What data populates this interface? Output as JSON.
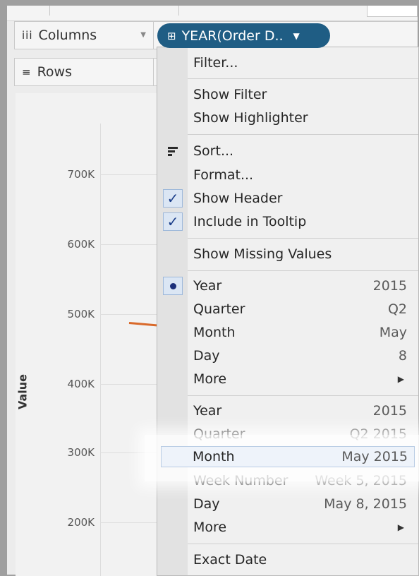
{
  "shelves": {
    "columns_label": "Columns",
    "columns_glyph": "iii",
    "rows_label": "Rows",
    "rows_glyph": "≡"
  },
  "pill": {
    "label": "YEAR(Order D..",
    "icon": "expand-plus-icon",
    "color": "#1f5d84"
  },
  "chart_data": {
    "type": "line",
    "ylabel": "Value",
    "y_ticks": [
      "700K",
      "600K",
      "500K",
      "400K",
      "300K",
      "200K"
    ],
    "series_color": "#d9692a"
  },
  "menu": {
    "filter": "Filter...",
    "show_filter": "Show Filter",
    "show_highlighter": "Show Highlighter",
    "sort": "Sort...",
    "format": "Format...",
    "show_header": "Show Header",
    "include_tooltip": "Include in Tooltip",
    "show_missing": "Show Missing Values",
    "discrete": [
      {
        "label": "Year",
        "value": "2015"
      },
      {
        "label": "Quarter",
        "value": "Q2"
      },
      {
        "label": "Month",
        "value": "May"
      },
      {
        "label": "Day",
        "value": "8"
      },
      {
        "label": "More",
        "value": ""
      }
    ],
    "continuous": [
      {
        "label": "Year",
        "value": "2015"
      },
      {
        "label": "Quarter",
        "value": "Q2 2015"
      },
      {
        "label": "Month",
        "value": "May 2015"
      },
      {
        "label": "Week Number",
        "value": "Week 5, 2015"
      },
      {
        "label": "Day",
        "value": "May 8, 2015"
      },
      {
        "label": "More",
        "value": ""
      }
    ],
    "exact_date": "Exact Date"
  }
}
